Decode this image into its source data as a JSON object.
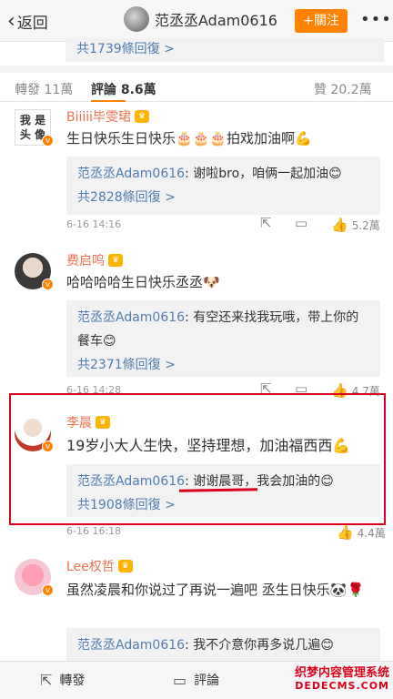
{
  "header": {
    "back_label": "返回",
    "title": "范丞丞Adam0616",
    "follow_label": "+關注",
    "more_icon": "more-icon"
  },
  "prev_reply": {
    "count_text": "共1739條回復 >"
  },
  "tabs": {
    "repost": "轉發 11萬",
    "comments": "評論 8.6萬",
    "likes": "贊 20.2萬"
  },
  "comments": [
    {
      "avatar_text": "我 是\n头 像",
      "name": "Biiiii毕雯珺",
      "text": "生日快乐生日快乐🎂🎂🎂拍戏加油啊💪",
      "reply": {
        "who": "范丞丞Adam0616",
        "text": ": 谢啦bro，咱俩一起加油😊"
      },
      "reply_count": "共2828條回復 >",
      "date": "6-16 14:16",
      "likes": "5.2萬"
    },
    {
      "name": "费启鸣",
      "text": "哈哈哈哈生日快乐丞丞🐶",
      "reply": {
        "who": "范丞丞Adam0616",
        "text": ": 有空还来找我玩哦，带上你的餐车😊"
      },
      "reply_count": "共2371條回復 >",
      "date": "6-16 14:28",
      "likes": "4.7萬"
    },
    {
      "name": "李晨",
      "text": "19岁小大人生快，坚持理想，加油福西西💪",
      "reply": {
        "who": "范丞丞Adam0616",
        "text": ": 谢谢晨哥，我会加油的😊"
      },
      "reply_count": "共1908條回復 >",
      "date": "6-16 16:18",
      "likes": "4.4萬"
    },
    {
      "name": "Lee权哲",
      "text": "虽然凌晨和你说过了再说一遍吧 丞生日快乐🐼🌹",
      "reply": {
        "who": "范丞丞Adam0616",
        "text": ": 我不介意你再多说几遍😊"
      }
    }
  ],
  "bottom": {
    "repost": "轉發",
    "comment": "評論"
  },
  "watermark": {
    "line1": "织梦内容管理系统",
    "line2": "DEDECMS.COM"
  },
  "colors": {
    "accent": "#ff8200",
    "link": "#507daf",
    "highlight": "#d9001b"
  }
}
